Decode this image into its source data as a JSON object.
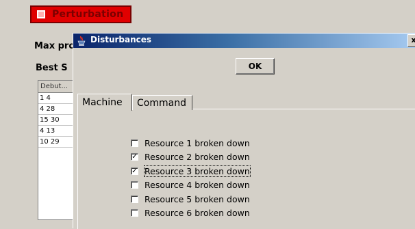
{
  "background_app": {
    "perturbation_button": "Perturbation",
    "max_label": "Max pro",
    "best_label": "Best S",
    "table": {
      "header": "Debut...",
      "rows": [
        "1 4",
        "4 28",
        "15 30",
        "4 13",
        "10 29"
      ]
    }
  },
  "dialog": {
    "title": "Disturbances",
    "close_glyph": "x",
    "ok_label": "OK",
    "tabs": [
      {
        "label": "Machine",
        "selected": true
      },
      {
        "label": "Command",
        "selected": false
      }
    ],
    "resources": [
      {
        "label": "Resource 1 broken down",
        "checked": false
      },
      {
        "label": "Resource 2 broken down",
        "checked": true
      },
      {
        "label": "Resource 3 broken down",
        "checked": true,
        "focused": true
      },
      {
        "label": "Resource 4 broken down",
        "checked": false
      },
      {
        "label": "Resource 5 broken down",
        "checked": false
      },
      {
        "label": "Resource 6 broken down",
        "checked": false
      }
    ]
  }
}
